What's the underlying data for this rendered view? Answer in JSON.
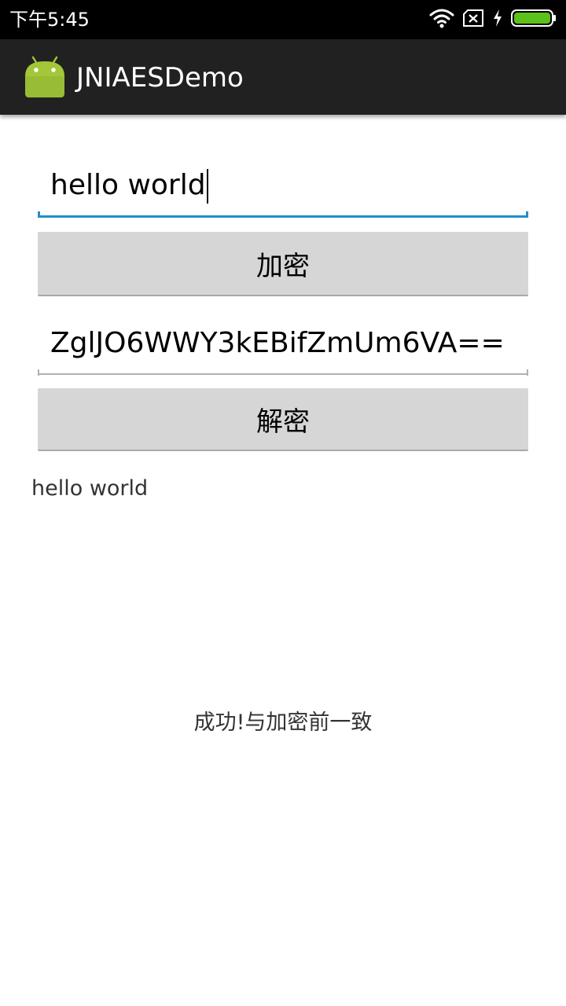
{
  "status_bar": {
    "time": "下午5:45",
    "icons": [
      "wifi-icon",
      "sim-disabled-icon",
      "charging-icon",
      "battery-icon"
    ],
    "battery_color": "#5cc11b"
  },
  "action_bar": {
    "title": "JNIAESDemo",
    "icon": "android-icon"
  },
  "main": {
    "input_plain": {
      "value": "hello world"
    },
    "encrypt_button": {
      "label": "加密"
    },
    "input_cipher": {
      "value": "ZglJO6WWY3kEBifZmUm6VA=="
    },
    "decrypt_button": {
      "label": "解密"
    },
    "decrypted_text": "hello world",
    "result_message": "成功!与加密前一致"
  },
  "colors": {
    "accent": "#1e90c8",
    "status_bar": "#000000",
    "action_bar": "#212121",
    "button": "#d6d6d6"
  }
}
